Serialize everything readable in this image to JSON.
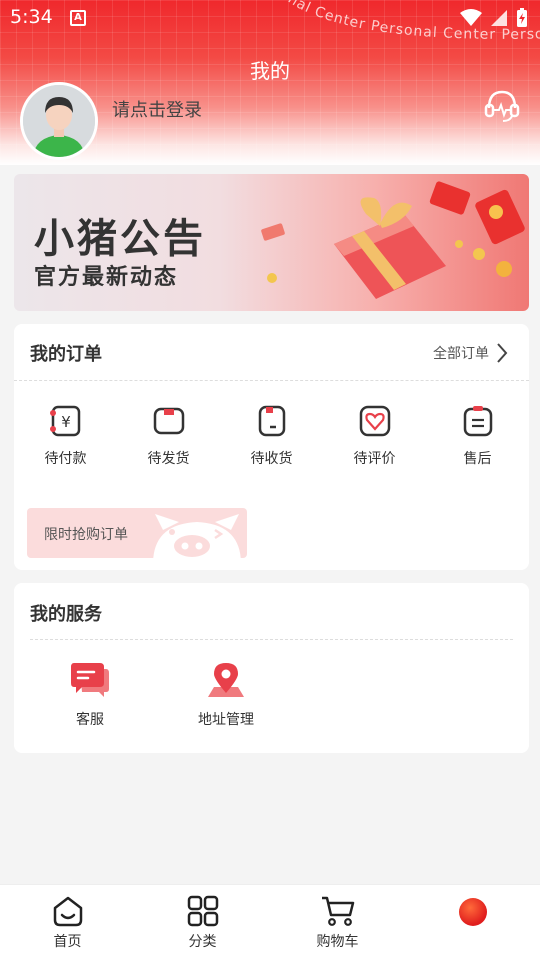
{
  "status_bar": {
    "time": "5:34",
    "a_badge": "A"
  },
  "header": {
    "title": "我的",
    "login_prompt": "请点击登录",
    "watermark": "onal Center Personal Center Person"
  },
  "banner": {
    "title": "小猪公告",
    "subtitle": "官方最新动态"
  },
  "orders": {
    "title": "我的订单",
    "all_label": "全部订单",
    "items": [
      {
        "label": "待付款",
        "icon": "wallet-icon"
      },
      {
        "label": "待发货",
        "icon": "package-icon"
      },
      {
        "label": "待收货",
        "icon": "receive-icon"
      },
      {
        "label": "待评价",
        "icon": "heart-icon"
      },
      {
        "label": "售后",
        "icon": "after-sale-icon"
      }
    ],
    "flash_sale_label": "限时抢购订单"
  },
  "services": {
    "title": "我的服务",
    "items": [
      {
        "label": "客服",
        "icon": "chat-icon"
      },
      {
        "label": "地址管理",
        "icon": "location-icon"
      }
    ]
  },
  "nav": {
    "items": [
      {
        "label": "首页",
        "icon": "home-icon"
      },
      {
        "label": "分类",
        "icon": "category-icon"
      },
      {
        "label": "购物车",
        "icon": "cart-icon"
      },
      {
        "label": "",
        "icon": "profile-dot-icon"
      }
    ]
  },
  "colors": {
    "accent": "#f0282c",
    "icon_red": "#e8404a"
  }
}
